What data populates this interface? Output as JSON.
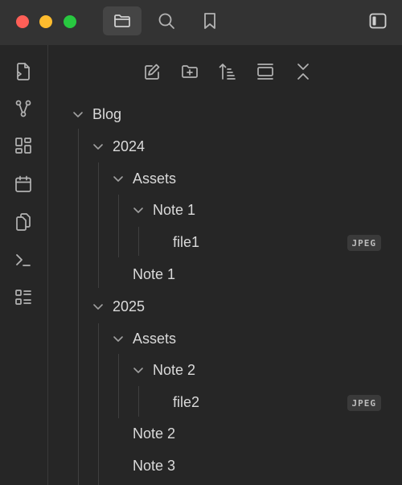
{
  "window": {
    "traffic_lights": {
      "close_color": "#ff5f57",
      "minimize_color": "#febc2e",
      "zoom_color": "#28c840"
    }
  },
  "titlebar": {
    "tabs": [
      {
        "icon": "folder-icon",
        "active": true
      },
      {
        "icon": "search-icon",
        "active": false
      },
      {
        "icon": "bookmark-icon",
        "active": false
      }
    ],
    "right_icon": "sidebar-toggle-icon"
  },
  "ribbon": {
    "icons": [
      "new-note-icon",
      "graph-icon",
      "canvas-icon",
      "calendar-icon",
      "copy-files-icon",
      "terminal-icon",
      "list-icon"
    ]
  },
  "explorer": {
    "toolbar": [
      "new-note-icon",
      "new-folder-icon",
      "sort-icon",
      "view-icon",
      "collapse-all-icon"
    ],
    "tree": {
      "blog": "Blog",
      "y2024": "2024",
      "assets_2024": "Assets",
      "note1_folder": "Note 1",
      "file1": "file1",
      "file1_ext": "JPEG",
      "note1": "Note 1",
      "y2025": "2025",
      "assets_2025": "Assets",
      "note2_folder": "Note 2",
      "file2": "file2",
      "file2_ext": "JPEG",
      "note2": "Note 2",
      "note3": "Note 3"
    }
  },
  "colors": {
    "background": "#262626",
    "titlebar": "#333333",
    "active_tab": "#454545",
    "text": "#dadada",
    "icon": "#b3b3b3"
  }
}
